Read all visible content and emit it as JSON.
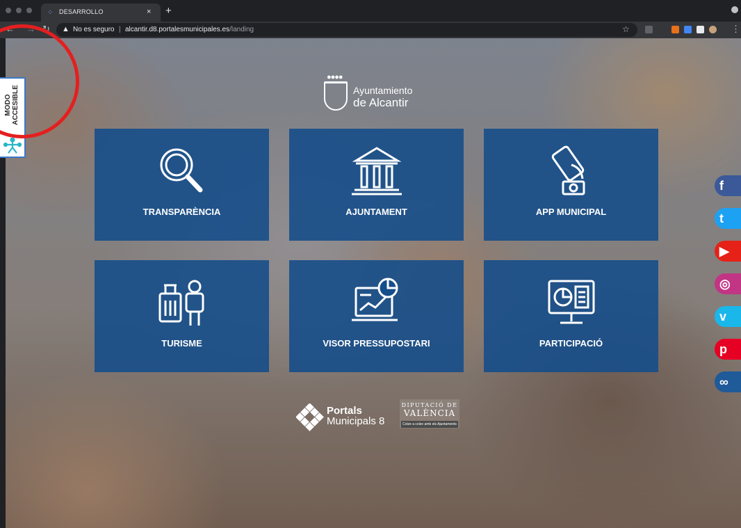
{
  "browser": {
    "tab_title": "DESARROLLO",
    "tab_close": "×",
    "new_tab": "+",
    "security_label": "No es seguro",
    "url_host": "alcantir.d8.portalesmunicipales.es",
    "url_path": "/landing"
  },
  "logo": {
    "line1": "Ayuntamiento",
    "line2": "de Alcantir"
  },
  "accessibility": {
    "line1": "MODO",
    "line2": "ACCESIBLE"
  },
  "tiles": [
    {
      "label": "TRANSPARÈNCIA",
      "icon": "magnifier-icon"
    },
    {
      "label": "AJUNTAMENT",
      "icon": "town-hall-icon"
    },
    {
      "label": "APP MUNICIPAL",
      "icon": "mobile-app-icon"
    },
    {
      "label": "TURISME",
      "icon": "tourist-luggage-icon"
    },
    {
      "label": "VISOR PRESSUPOSTARI",
      "icon": "budget-chart-icon"
    },
    {
      "label": "PARTICIPACIÓ",
      "icon": "monitor-chart-icon"
    }
  ],
  "footer": {
    "portals_bold": "Portals",
    "portals_light": "Municipals 8",
    "dip_top": "DIPUTACIÓ DE",
    "dip_main": "VALÈNCIA",
    "dip_tagline": "Colze a colze amb els Ajuntaments"
  },
  "social": [
    {
      "name": "facebook",
      "glyph": "f",
      "color": "#3b5998"
    },
    {
      "name": "twitter",
      "glyph": "t",
      "color": "#1da1f2"
    },
    {
      "name": "youtube",
      "glyph": "▶",
      "color": "#e62117"
    },
    {
      "name": "instagram",
      "glyph": "◎",
      "color": "#c13584"
    },
    {
      "name": "vimeo",
      "glyph": "v",
      "color": "#1ab7ea"
    },
    {
      "name": "pinterest",
      "glyph": "p",
      "color": "#e60023"
    },
    {
      "name": "link",
      "glyph": "∞",
      "color": "#1f5a99"
    }
  ]
}
